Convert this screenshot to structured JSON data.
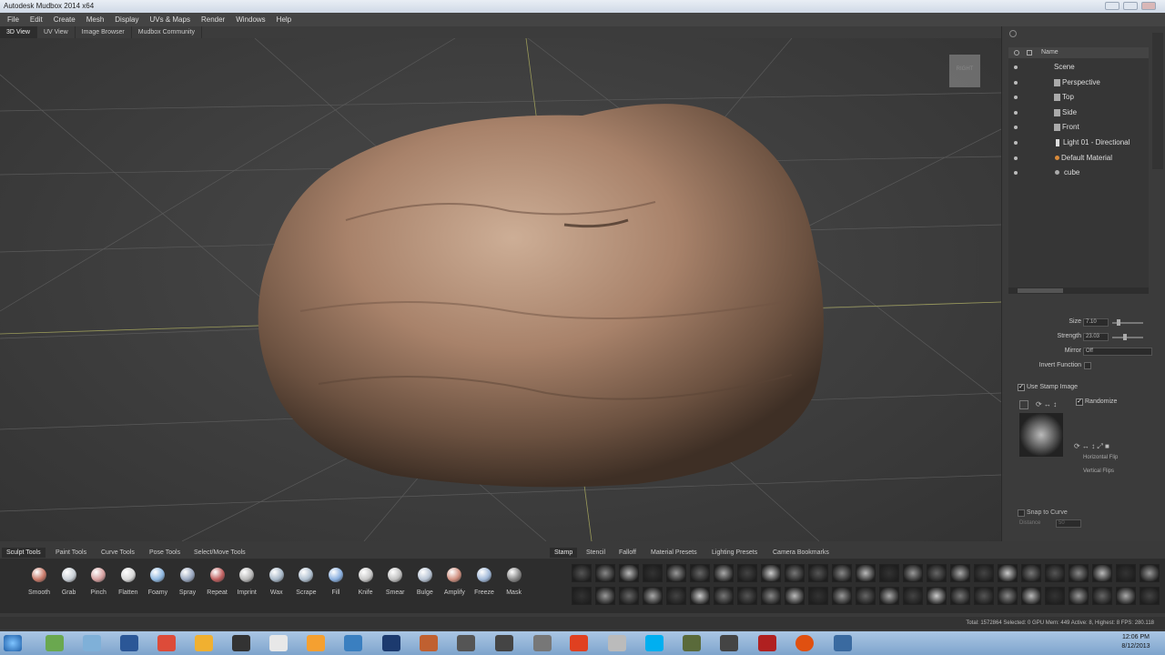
{
  "app": {
    "title": "Autodesk Mudbox 2014 x64"
  },
  "menu": [
    "File",
    "Edit",
    "Create",
    "Mesh",
    "Display",
    "UVs & Maps",
    "Render",
    "Windows",
    "Help"
  ],
  "view_tabs": [
    "3D View",
    "UV View",
    "Image Browser",
    "Mudbox Community"
  ],
  "viewport": {
    "viewcube_label": "RIGHT"
  },
  "outliner": {
    "header": "Name",
    "items": [
      {
        "label": "Scene"
      },
      {
        "label": "Perspective"
      },
      {
        "label": "Top"
      },
      {
        "label": "Side"
      },
      {
        "label": "Front"
      },
      {
        "label": "Light 01 - Directional"
      },
      {
        "label": "Default Material"
      },
      {
        "label": "cube"
      }
    ]
  },
  "properties": {
    "size_label": "Size",
    "size_value": "7.10",
    "strength_label": "Strength",
    "strength_value": "23.03",
    "mirror_label": "Mirror",
    "mirror_value": "Off",
    "invert_label": "Invert Function",
    "use_stamp_label": "Use Stamp Image",
    "randomize_label": "Randomize",
    "hflip_label": "Horizontal Flip",
    "vflip_label": "Vertical Flips",
    "snap_label": "Snap to Curve",
    "distance_label": "Distance",
    "distance_value": "50"
  },
  "tool_tabs": [
    "Sculpt Tools",
    "Paint Tools",
    "Curve Tools",
    "Pose Tools",
    "Select/Move Tools"
  ],
  "stamp_tabs": [
    "Stamp",
    "Stencil",
    "Falloff",
    "Material Presets",
    "Lighting Presets",
    "Camera Bookmarks"
  ],
  "tools": [
    {
      "label": "Smooth",
      "color": "#c97a6a"
    },
    {
      "label": "Grab",
      "color": "#c9cfd6"
    },
    {
      "label": "Pinch",
      "color": "#d6a0a0"
    },
    {
      "label": "Flatten",
      "color": "#d8d8d8"
    },
    {
      "label": "Foamy",
      "color": "#8fb8e0"
    },
    {
      "label": "Spray",
      "color": "#9aa8c0"
    },
    {
      "label": "Repeat",
      "color": "#c06060"
    },
    {
      "label": "Imprint",
      "color": "#b8b8b8"
    },
    {
      "label": "Wax",
      "color": "#a8b8c8"
    },
    {
      "label": "Scrape",
      "color": "#b0c0d0"
    },
    {
      "label": "Fill",
      "color": "#8ab0e0"
    },
    {
      "label": "Knife",
      "color": "#c8c8c8"
    },
    {
      "label": "Smear",
      "color": "#c0c0c0"
    },
    {
      "label": "Bulge",
      "color": "#b8c4d4"
    },
    {
      "label": "Amplify",
      "color": "#d09080"
    },
    {
      "label": "Freeze",
      "color": "#a0b8d8"
    },
    {
      "label": "Mask",
      "color": "#888888"
    }
  ],
  "status": {
    "text": "Total: 1572864  Selected: 0 GPU Mem: 449  Active: 8, Highest: 8  FPS: 280.118"
  },
  "clock": {
    "time": "12:06 PM",
    "date": "8/12/2013"
  }
}
